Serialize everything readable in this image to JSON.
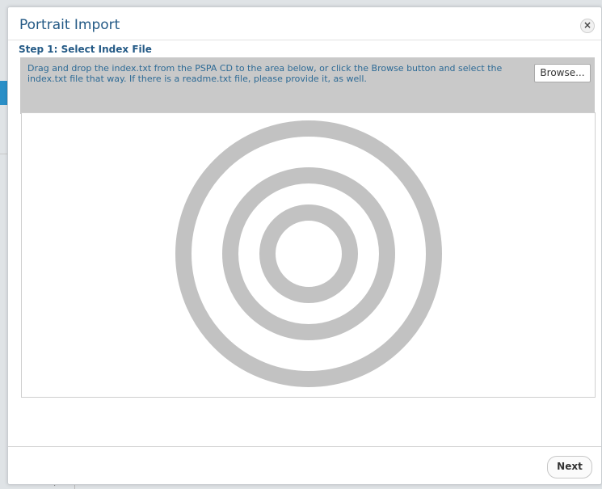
{
  "dialog": {
    "title": "Portrait Import",
    "close_icon": "close-icon"
  },
  "step": {
    "heading": "Step 1: Select Index File"
  },
  "instructions": {
    "text": "Drag and drop the index.txt from the PSPA CD to the area below, or click the Browse button and select the index.txt file that way. If there is a readme.txt file, please provide it, as well.",
    "browse_label": "Browse..."
  },
  "dropzone": {
    "icon": "target-icon",
    "ring_color": "#c2c2c2"
  },
  "footer": {
    "next_label": "Next"
  },
  "background": {
    "chevron": "›"
  }
}
